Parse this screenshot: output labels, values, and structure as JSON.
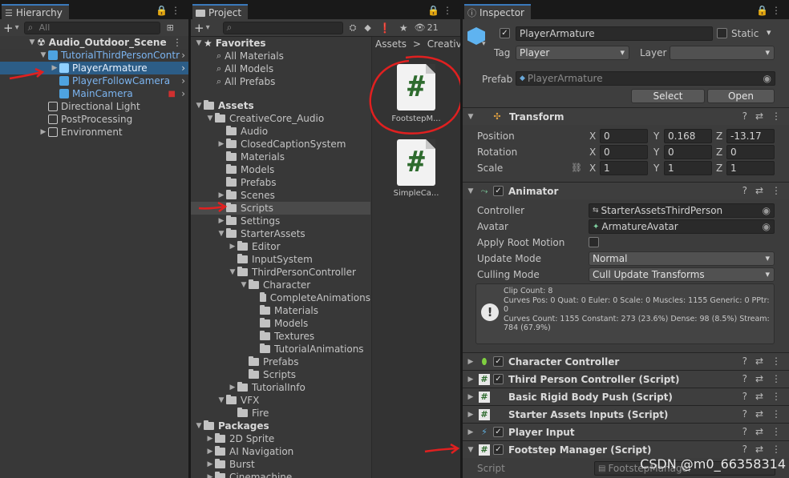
{
  "hierarchy": {
    "tab_title": "Hierarchy",
    "search_placeholder": "All",
    "scene_name": "Audio_Outdoor_Scene",
    "items": [
      {
        "label": "TutorialThirdPersonContr"
      },
      {
        "label": "PlayerArmature"
      },
      {
        "label": "PlayerFollowCamera"
      },
      {
        "label": "MainCamera"
      },
      {
        "label": "Directional Light"
      },
      {
        "label": "PostProcessing"
      },
      {
        "label": "Environment"
      }
    ]
  },
  "project": {
    "tab_title": "Project",
    "visible_count": "21",
    "breadcrumb": [
      "Assets",
      "CreativeC"
    ],
    "favorites_label": "Favorites",
    "favorites": [
      "All Materials",
      "All Models",
      "All Prefabs"
    ],
    "assets_label": "Assets",
    "tree": [
      "CreativeCore_Audio",
      "Audio",
      "ClosedCaptionSystem",
      "Materials",
      "Models",
      "Prefabs",
      "Scenes",
      "Scripts",
      "Settings",
      "StarterAssets",
      "Editor",
      "InputSystem",
      "ThirdPersonController",
      "Character",
      "CompleteAnimations",
      "Materials",
      "Models",
      "Textures",
      "TutorialAnimations",
      "Prefabs",
      "Scripts",
      "TutorialInfo",
      "VFX",
      "Fire"
    ],
    "packages_label": "Packages",
    "packages": [
      "2D Sprite",
      "AI Navigation",
      "Burst",
      "Cinemachine"
    ],
    "files": [
      {
        "label": "FootstepM..."
      },
      {
        "label": "SimpleCa..."
      }
    ]
  },
  "inspector": {
    "tab_title": "Inspector",
    "object_name": "PlayerArmature",
    "static_label": "Static",
    "tag_label": "Tag",
    "tag_value": "Player",
    "layer_label": "Layer",
    "layer_value": "",
    "prefab_label": "Prefab",
    "prefab_value": "PlayerArmature",
    "select_button": "Select",
    "open_button": "Open",
    "transform": {
      "title": "Transform",
      "position_label": "Position",
      "rotation_label": "Rotation",
      "scale_label": "Scale",
      "position": [
        "0",
        "0.168",
        "-13.17"
      ],
      "rotation": [
        "0",
        "0",
        "0"
      ],
      "scale": [
        "1",
        "1",
        "1"
      ],
      "axes": [
        "X",
        "Y",
        "Z"
      ]
    },
    "animator": {
      "title": "Animator",
      "controller_label": "Controller",
      "controller_value": "StarterAssetsThirdPerson",
      "avatar_label": "Avatar",
      "avatar_value": "ArmatureAvatar",
      "root_motion_label": "Apply Root Motion",
      "update_mode_label": "Update Mode",
      "update_mode_value": "Normal",
      "culling_mode_label": "Culling Mode",
      "culling_mode_value": "Cull Update Transforms",
      "info_lines": [
        "Clip Count: 8",
        "Curves Pos: 0 Quat: 0 Euler: 0 Scale: 0 Muscles: 1155 Generic: 0 PPtr:",
        "0",
        "Curves Count: 1155 Constant: 273 (23.6%) Dense: 98 (8.5%) Stream:",
        "784 (67.9%)"
      ]
    },
    "components": [
      {
        "title": "Character Controller"
      },
      {
        "title": "Third Person Controller (Script)"
      },
      {
        "title": "Basic Rigid Body Push (Script)"
      },
      {
        "title": "Starter Assets Inputs (Script)"
      },
      {
        "title": "Player Input"
      },
      {
        "title": "Footstep Manager (Script)"
      }
    ],
    "script_label": "Script",
    "script_value": "FootstepManager"
  },
  "watermark": "CSDN @m0_66358314",
  "colors": {
    "selection": "#2c5d87",
    "annotation_red": "#e02020",
    "script_green": "#2e6b2e",
    "link_blue": "#7bb4f0"
  }
}
